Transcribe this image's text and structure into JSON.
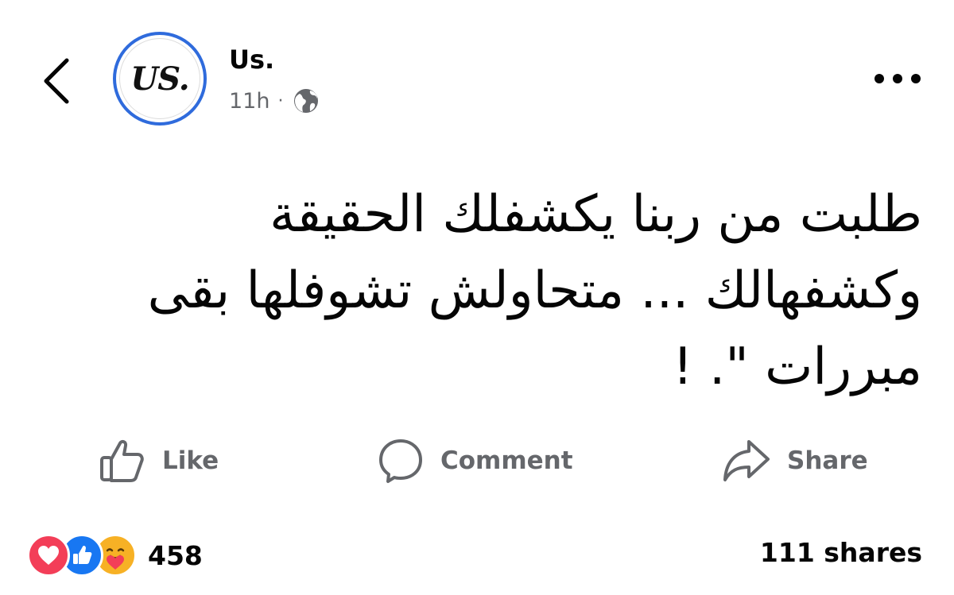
{
  "post": {
    "author": "Us.",
    "avatar_text": "US.",
    "time": "11h",
    "separator": "·",
    "privacy_icon": "globe-icon",
    "text_lines": [
      "طلبت من ربنا يكشفلك الحقيقة",
      "وكشفهالك ... متحاولش تشوفلها بقى",
      "مبررات \". !"
    ]
  },
  "actions": {
    "like": "Like",
    "comment": "Comment",
    "share": "Share"
  },
  "footer": {
    "reaction_icons": [
      "love-reaction-icon",
      "like-reaction-icon",
      "care-reaction-icon"
    ],
    "reaction_count": "458",
    "shares": "111 shares"
  },
  "colors": {
    "avatar_ring": "#2f6bdc",
    "secondary_text": "#65676b",
    "love": "#f33e58",
    "like": "#1877f2",
    "care": "#f7b125"
  }
}
